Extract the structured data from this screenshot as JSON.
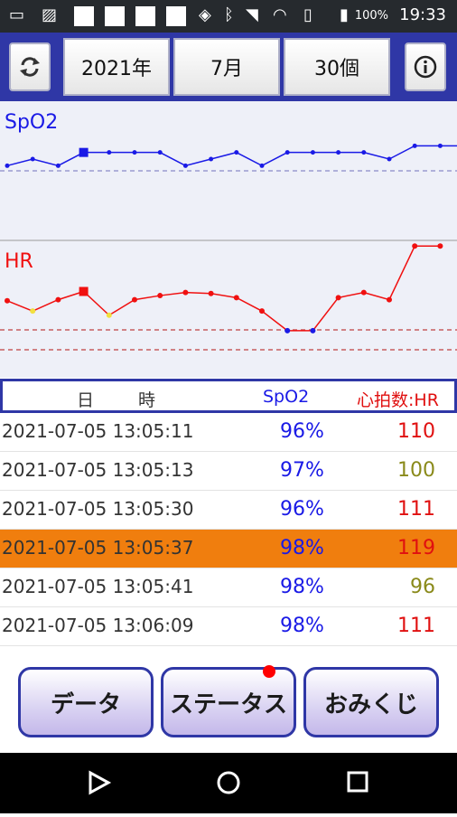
{
  "statusbar": {
    "battery": "100%",
    "time": "19:33"
  },
  "toolbar": {
    "year": "2021年",
    "month": "7月",
    "count": "30個"
  },
  "chart": {
    "spo2_label": "SpO2",
    "hr_label": "HR",
    "colors": {
      "spo2": "#1a1ae6",
      "hr": "#f01010",
      "hr_low": "#f2e040",
      "selected_marker": "#f01010"
    }
  },
  "chart_data": {
    "type": "line",
    "series": [
      {
        "name": "SpO2",
        "values": [
          96,
          97,
          96,
          98,
          98,
          98,
          98,
          96,
          97,
          98,
          96,
          98,
          98,
          98,
          98,
          97,
          99,
          99,
          99,
          99
        ]
      },
      {
        "name": "HR",
        "values": [
          110,
          100,
          111,
          119,
          96,
          111,
          115,
          118,
          117,
          113,
          100,
          81,
          81,
          113,
          118,
          111,
          163,
          163
        ]
      }
    ]
  },
  "table": {
    "headers": {
      "date": "日",
      "time": "時",
      "spo2": "SpO2",
      "hr": "心拍数:HR"
    },
    "rows": [
      {
        "datetime": "2021-07-05 13:05:11",
        "spo2": "96%",
        "hr": "110",
        "hr_color": "#e01010"
      },
      {
        "datetime": "2021-07-05 13:05:13",
        "spo2": "97%",
        "hr": "100",
        "hr_color": "#8a8a1a"
      },
      {
        "datetime": "2021-07-05 13:05:30",
        "spo2": "96%",
        "hr": "111",
        "hr_color": "#e01010"
      },
      {
        "datetime": "2021-07-05 13:05:37",
        "spo2": "98%",
        "hr": "119",
        "hr_color": "#e01010"
      },
      {
        "datetime": "2021-07-05 13:05:41",
        "spo2": "98%",
        "hr": "96",
        "hr_color": "#8a8a1a"
      },
      {
        "datetime": "2021-07-05 13:06:09",
        "spo2": "98%",
        "hr": "111",
        "hr_color": "#e01010"
      }
    ]
  },
  "bottom": {
    "data_btn": "データ",
    "status_btn": "ステータス",
    "omikuji_btn": "おみくじ"
  }
}
